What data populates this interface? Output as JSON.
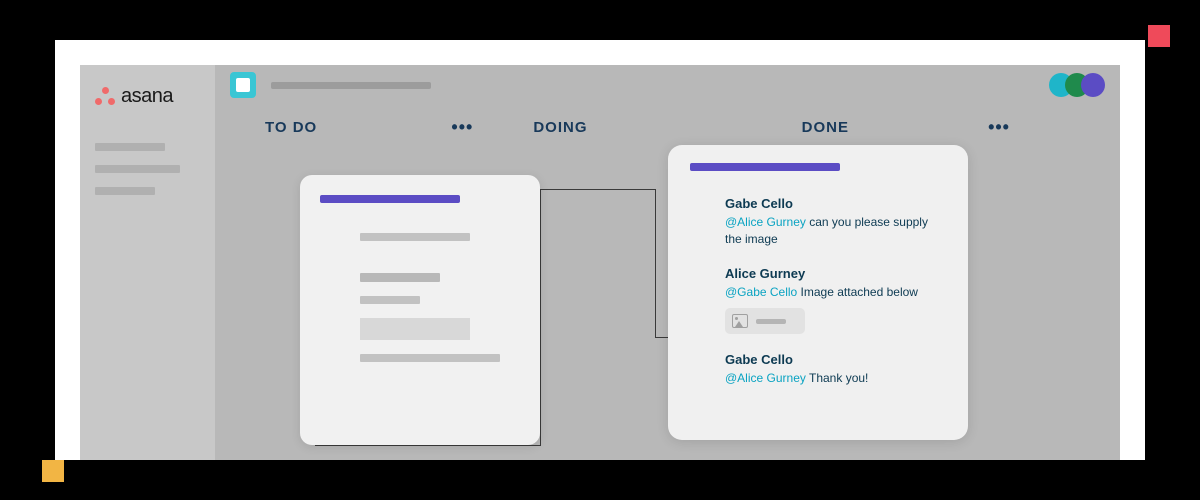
{
  "brand": {
    "name": "asana"
  },
  "columns": [
    {
      "title": "TO DO",
      "menu": "•••"
    },
    {
      "title": "DOING",
      "menu": ""
    },
    {
      "title": "DONE",
      "menu": "•••"
    }
  ],
  "comments": [
    {
      "author": "Gabe Cello",
      "mention": "@Alice Gurney",
      "text": " can you please supply the image"
    },
    {
      "author": "Alice Gurney",
      "mention": "@Gabe Cello",
      "text": " Image attached below",
      "has_attachment": true
    },
    {
      "author": "Gabe Cello",
      "mention": "@Alice Gurney",
      "text": " Thank you!"
    }
  ]
}
